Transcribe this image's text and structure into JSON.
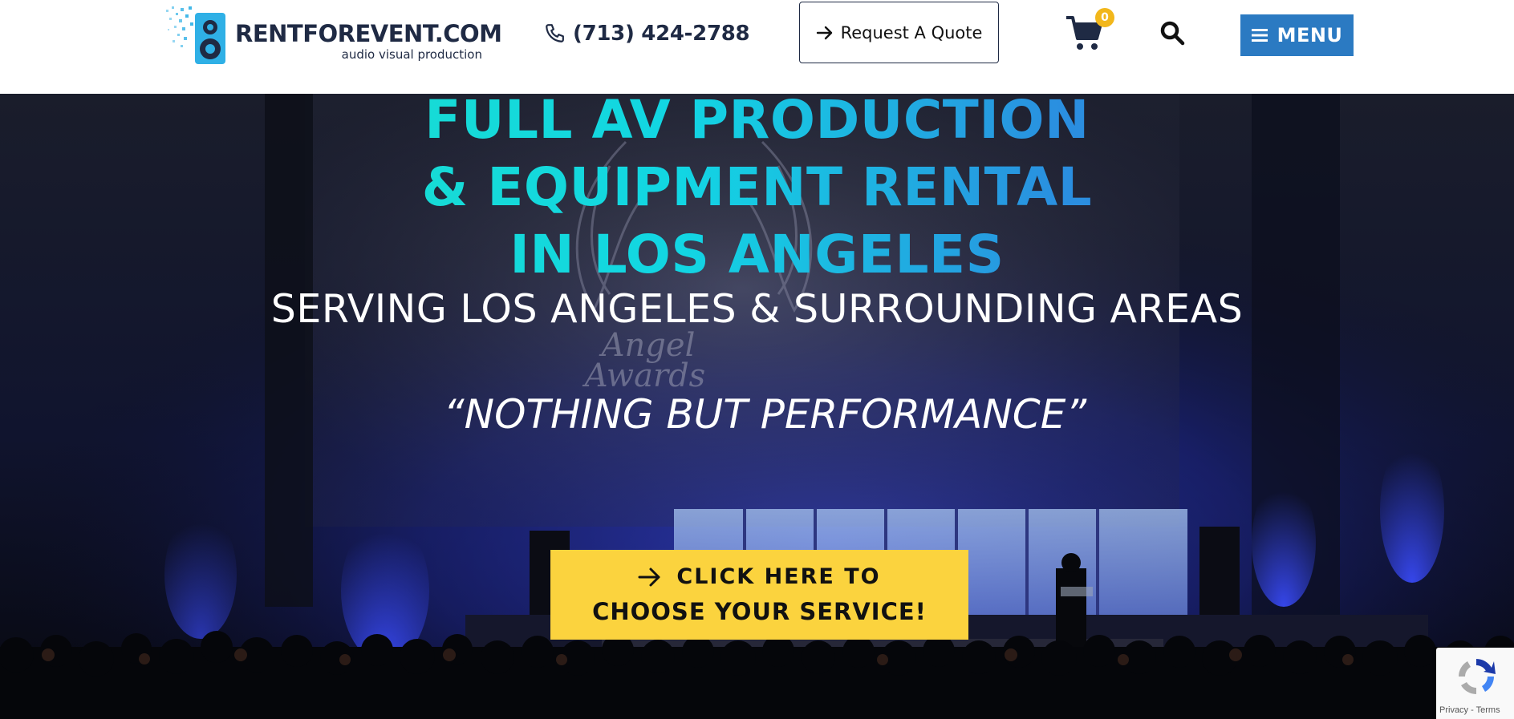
{
  "header": {
    "logo": {
      "name": "RENTFOREVENT.COM",
      "tagline": "audio visual production",
      "icon": "speaker-logo-icon"
    },
    "phone": {
      "number": "(713) 424-2788",
      "icon": "phone-icon"
    },
    "quote_button": {
      "label": "Request A Quote",
      "icon": "arrow-right-icon"
    },
    "cart": {
      "count": "0",
      "icon": "cart-icon"
    },
    "search": {
      "icon": "search-icon"
    },
    "menu_button": {
      "label": "MENU",
      "icon": "hamburger-icon"
    }
  },
  "hero": {
    "headline": [
      "FULL AV PRODUCTION",
      "& EQUIPMENT RENTAL",
      "IN LOS ANGELES"
    ],
    "subheading": "SERVING LOS ANGELES & SURROUNDING AREAS",
    "tagline": "“NOTHING BUT PERFORMANCE”",
    "background_screen_text": [
      "Angel",
      "Awards"
    ],
    "cta": {
      "line1": "CLICK HERE TO",
      "line2": "CHOOSE YOUR SERVICE!",
      "icon": "arrow-right-icon"
    }
  },
  "recaptcha": {
    "links": "Privacy - Terms"
  },
  "colors": {
    "header_bg": "#ffffff",
    "brand_dark": "#1f2a44",
    "menu_blue": "#2b7ac2",
    "cta_yellow": "#fbd33e",
    "cart_badge": "#f2b71b",
    "headline_gradient_start": "#1de3c1",
    "headline_gradient_end": "#3c72d2"
  }
}
